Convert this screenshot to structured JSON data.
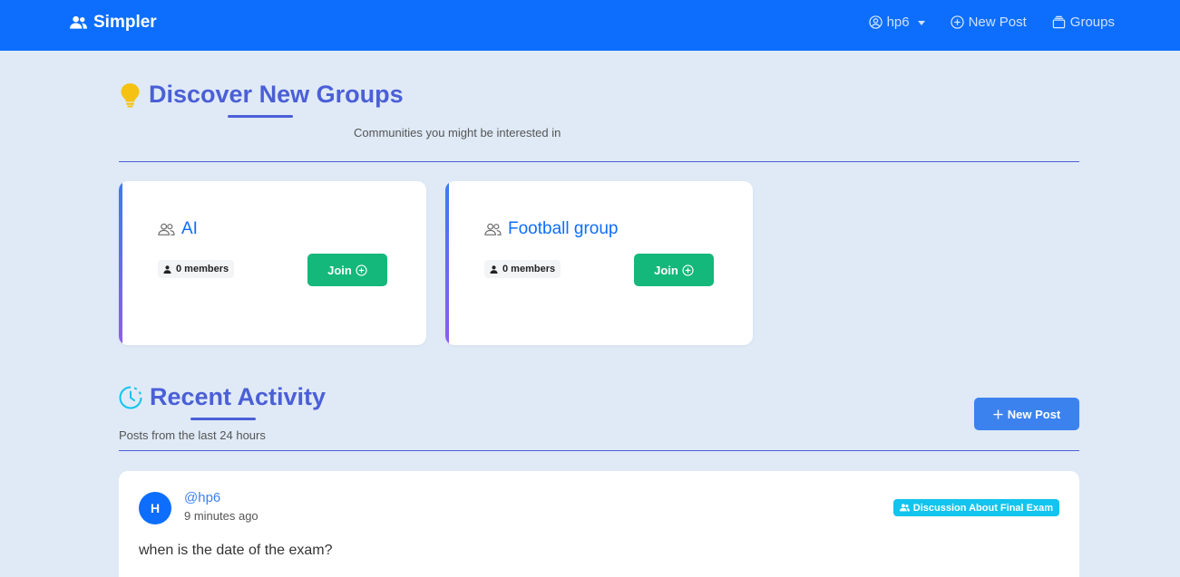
{
  "navbar": {
    "brand": "Simpler",
    "user": "hp6",
    "new_post": "New Post",
    "groups": "Groups"
  },
  "discover": {
    "title": "Discover New Groups",
    "subtitle": "Communities you might be interested in",
    "groups": [
      {
        "name": "AI",
        "members": "0 members",
        "join_label": "Join"
      },
      {
        "name": "Football group",
        "members": "0 members",
        "join_label": "Join"
      }
    ]
  },
  "recent": {
    "title": "Recent Activity",
    "subtitle": "Posts from the last 24 hours",
    "new_post_label": "New Post"
  },
  "post": {
    "avatar_letter": "H",
    "username": "@hp6",
    "time": "9 minutes ago",
    "group": "Discussion About Final Exam",
    "content": "when is the date of the exam?"
  },
  "colors": {
    "navbar": "#0d6efd",
    "accent": "#4b5fd6",
    "join": "#14b87a",
    "badge": "#12c4ee"
  }
}
